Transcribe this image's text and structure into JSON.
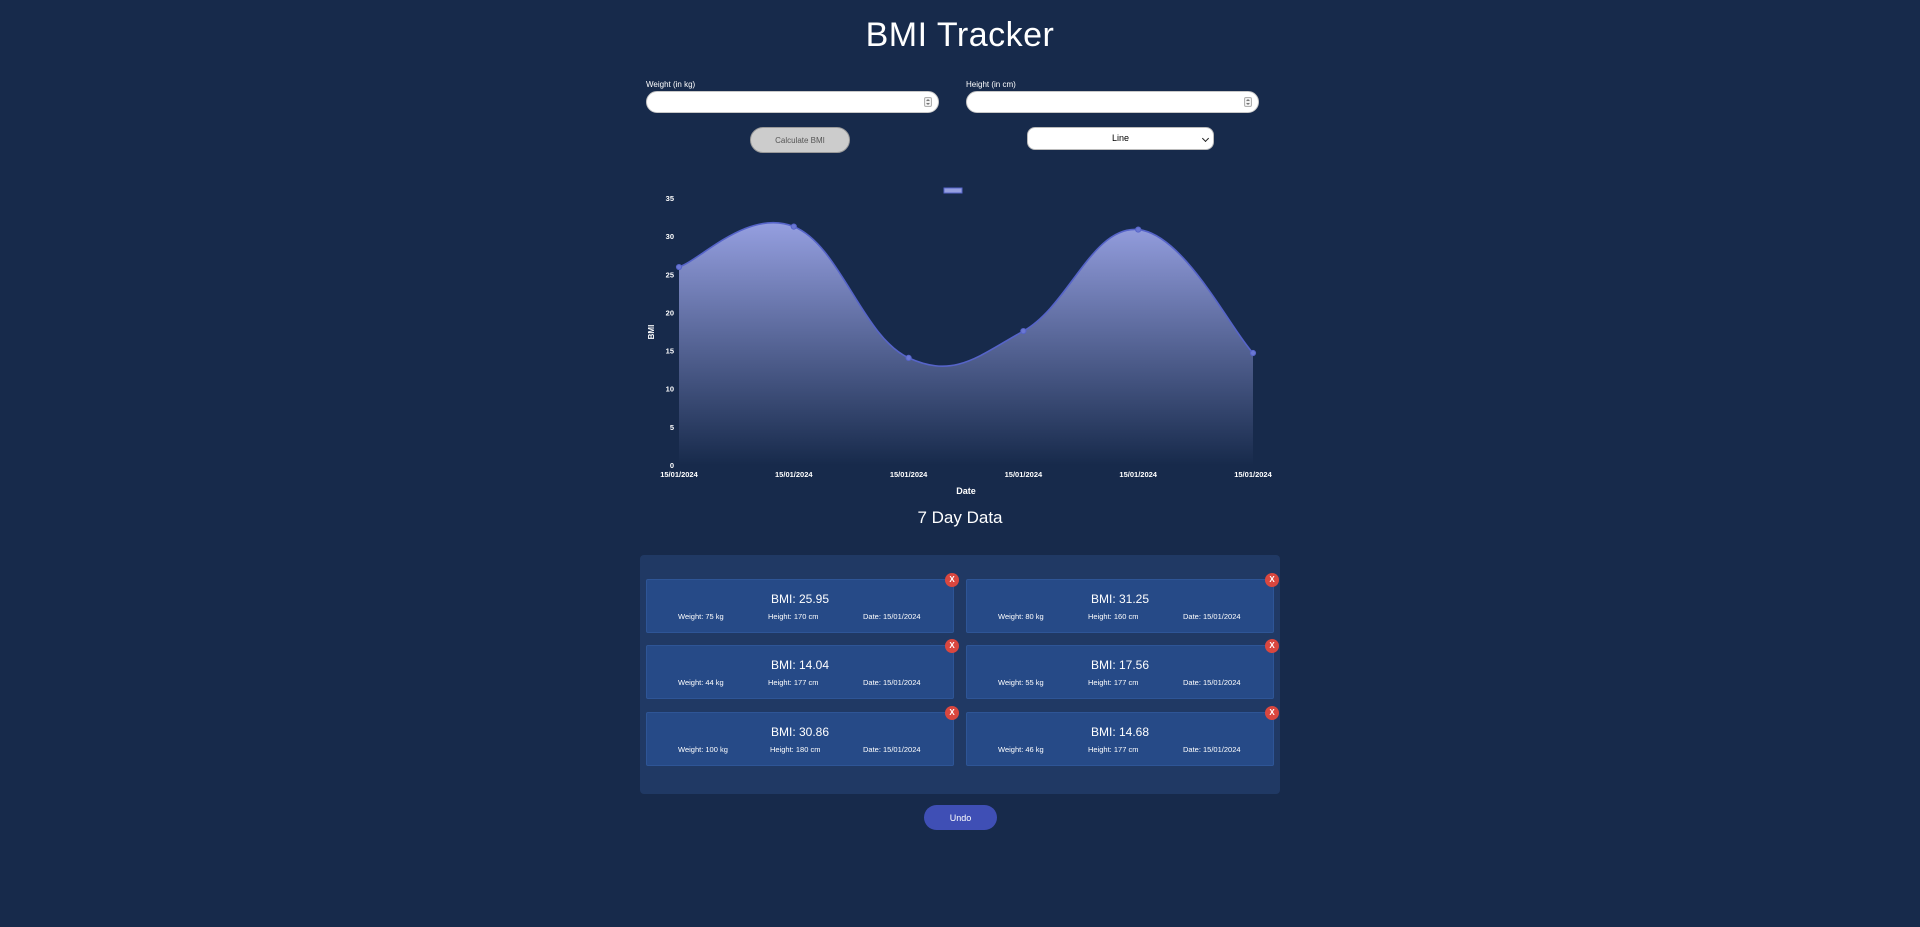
{
  "page_title": "BMI Tracker",
  "form": {
    "weight_label": "Weight (in kg)",
    "weight_value": "",
    "height_label": "Height (in cm)",
    "height_value": "",
    "calculate_label": "Calculate BMI",
    "chart_type_selected": "Line"
  },
  "colors": {
    "background": "#172a4b",
    "panel": "#203964",
    "card": "#264a87",
    "accent": "#3f4fb5",
    "line": "#5664c9",
    "area_top": "#959fe0",
    "delete": "#d9473f"
  },
  "chart_data": {
    "type": "area",
    "categories": [
      "15/01/2024",
      "15/01/2024",
      "15/01/2024",
      "15/01/2024",
      "15/01/2024",
      "15/01/2024"
    ],
    "series": [
      {
        "name": "",
        "values": [
          25.95,
          31.25,
          14.04,
          17.56,
          30.86,
          14.68
        ]
      }
    ],
    "xlabel": "Date",
    "ylabel": "BMI",
    "ylim": [
      0,
      35
    ],
    "yticks": [
      0,
      5,
      10,
      15,
      20,
      25,
      30,
      35
    ],
    "legend": "top-center",
    "grid": false,
    "smooth": true
  },
  "records_title": "7 Day Data",
  "records": [
    {
      "bmi": "BMI: 25.95",
      "weight": "Weight: 75 kg",
      "height": "Height: 170 cm",
      "date": "Date: 15/01/2024",
      "delete_label": "X"
    },
    {
      "bmi": "BMI: 31.25",
      "weight": "Weight: 80 kg",
      "height": "Height: 160 cm",
      "date": "Date: 15/01/2024",
      "delete_label": "X"
    },
    {
      "bmi": "BMI: 14.04",
      "weight": "Weight: 44 kg",
      "height": "Height: 177 cm",
      "date": "Date: 15/01/2024",
      "delete_label": "X"
    },
    {
      "bmi": "BMI: 17.56",
      "weight": "Weight: 55 kg",
      "height": "Height: 177 cm",
      "date": "Date: 15/01/2024",
      "delete_label": "X"
    },
    {
      "bmi": "BMI: 30.86",
      "weight": "Weight: 100 kg",
      "height": "Height: 180 cm",
      "date": "Date: 15/01/2024",
      "delete_label": "X"
    },
    {
      "bmi": "BMI: 14.68",
      "weight": "Weight: 46 kg",
      "height": "Height: 177 cm",
      "date": "Date: 15/01/2024",
      "delete_label": "X"
    }
  ],
  "undo_label": "Undo"
}
